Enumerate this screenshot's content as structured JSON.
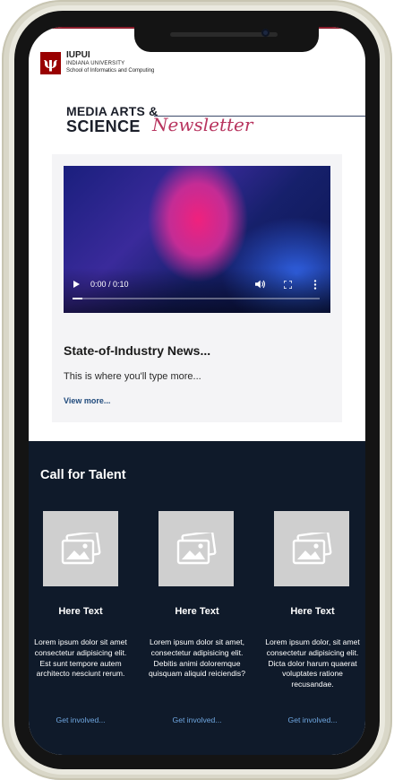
{
  "header": {
    "logo_mark": "ψ",
    "university_short": "IUPUI",
    "university_name": "INDIANA UNIVERSITY",
    "school": "School of Informatics and Computing"
  },
  "masthead": {
    "line1": "MEDIA ARTS &",
    "line2": "SCIENCE",
    "script": "Newsletter"
  },
  "feature": {
    "video_time": "0:00 / 0:10",
    "video_progress_fraction": 0.04,
    "title": "State-of-Industry News...",
    "body": "This is where you'll type more...",
    "link": "View more..."
  },
  "talent": {
    "title": "Call for Talent",
    "items": [
      {
        "heading": "Here Text",
        "text": "Lorem ipsum dolor sit amet consectetur adipisicing elit. Est sunt tempore autem architecto nesciunt rerum.",
        "link": "Get involved..."
      },
      {
        "heading": "Here Text",
        "text": "Lorem ipsum dolor sit amet, consectetur adipisicing elit. Debitis animi doloremque quisquam aliquid reiciendis?",
        "link": "Get involved..."
      },
      {
        "heading": "Here Text",
        "text": "Lorem ipsum dolor, sit amet consectetur adipisicing elit. Dicta dolor harum quaerat voluptates ratione recusandae.",
        "link": "Get involved..."
      }
    ]
  },
  "colors": {
    "brand_crimson": "#990000",
    "dark_section": "#0f1a2a",
    "link_blue": "#1f4a7c",
    "link_light": "#6fa7e0",
    "script_pink": "#b8355f"
  },
  "icons": {
    "placeholder": "image-placeholder-icon",
    "play": "play-icon",
    "volume": "volume-icon",
    "fullscreen": "fullscreen-icon",
    "more": "more-vertical-icon"
  }
}
